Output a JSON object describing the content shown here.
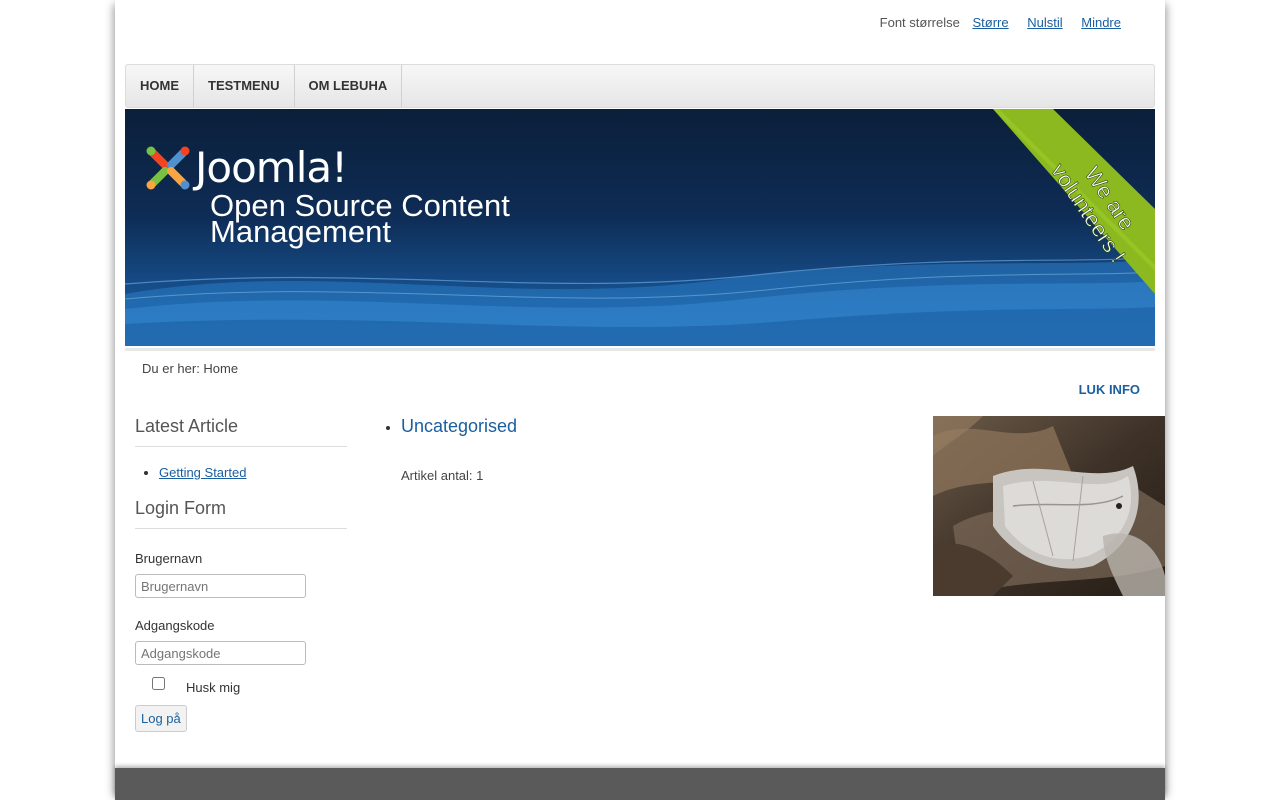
{
  "font_bar": {
    "label": "Font størrelse",
    "bigger": "Større",
    "reset": "Nulstil",
    "smaller": "Mindre"
  },
  "nav": {
    "items": [
      {
        "label": "HOME"
      },
      {
        "label": "TESTMENU"
      },
      {
        "label": "OM LEBUHA"
      }
    ]
  },
  "header": {
    "logo_text": "Joomla!",
    "slogan_line1": "Open Source Content",
    "slogan_line2": "Management",
    "ribbon_line1": "We are",
    "ribbon_line2": "volunteers !"
  },
  "breadcrumbs": {
    "text": "Du er her: Home"
  },
  "close_info": "LUK INFO",
  "sidebar": {
    "latest": {
      "title": "Latest Article",
      "items": [
        {
          "label": "Getting Started"
        }
      ]
    },
    "login": {
      "title": "Login Form",
      "username_label": "Brugernavn",
      "username_placeholder": "Brugernavn",
      "password_label": "Adgangskode",
      "password_placeholder": "Adgangskode",
      "remember_label": "Husk mig",
      "submit_label": "Log på"
    }
  },
  "content": {
    "category": "Uncategorised",
    "article_count": "Artikel antal: 1"
  },
  "colors": {
    "link": "#1a5fa0",
    "header_dark": "#0b1f3a",
    "ribbon": "#8cb820",
    "footer": "#5a5a5a"
  }
}
